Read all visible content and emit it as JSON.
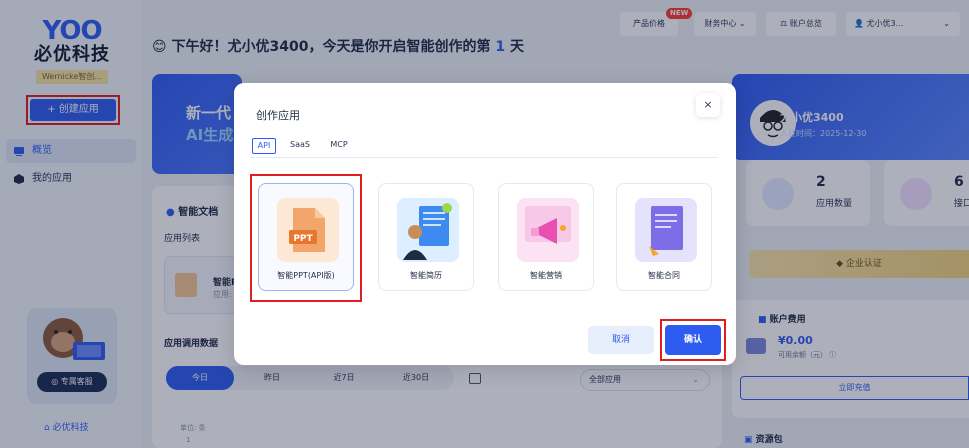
{
  "sidebar": {
    "logo_en": "YOO",
    "logo_cn": "必优科技",
    "user_tag": "Wernicke智创...",
    "create_label": "+ 创建应用",
    "items": [
      {
        "label": "概览"
      },
      {
        "label": "我的应用"
      }
    ],
    "service_label": "专属客服",
    "footer": "必优科技"
  },
  "header": {
    "greeting_prefix": "下午好！尤小优3400，今天是你开启智能创作的第",
    "day_count": "1",
    "greeting_suffix": "天",
    "emoji": "😊",
    "pricing": "产品价格",
    "new_tag": "NEW",
    "finance": "财务中心 ⌄",
    "account": "账户总览",
    "username": "尤小优3...",
    "chevron": "⌄"
  },
  "banner": {
    "line1": "新一代",
    "line2": "AI生成"
  },
  "main": {
    "smart_doc": "智能文档",
    "app_list": "应用列表",
    "app_card_name": "智能PPT",
    "app_card_sub": "应用:",
    "usage_title": "应用调用数据",
    "segments": [
      "今日",
      "昨日",
      "近7日",
      "近30日"
    ],
    "select_all": "全部应用",
    "unit": "单位: 条",
    "axis_one": "1"
  },
  "right": {
    "name": "尤小优3400",
    "join_date": "入驻时间：2025-12-30",
    "stat1_num": "2",
    "stat1_label": "应用数量",
    "stat2_num": "6",
    "stat2_label": "接口",
    "enterprise": "企业认证",
    "fee_title": "账户费用",
    "fee_amount": "¥0.00",
    "fee_sub": "可用余额（元） ⓘ",
    "recharge": "立即充值",
    "resource": "资源包"
  },
  "modal": {
    "title": "创作应用",
    "close": "×",
    "tabs": [
      "API",
      "SaaS",
      "MCP"
    ],
    "options": [
      {
        "label": "智能PPT(API版)"
      },
      {
        "label": "智能简历"
      },
      {
        "label": "智能营销"
      },
      {
        "label": "智能合同"
      }
    ],
    "cancel": "取消",
    "confirm": "确认"
  }
}
